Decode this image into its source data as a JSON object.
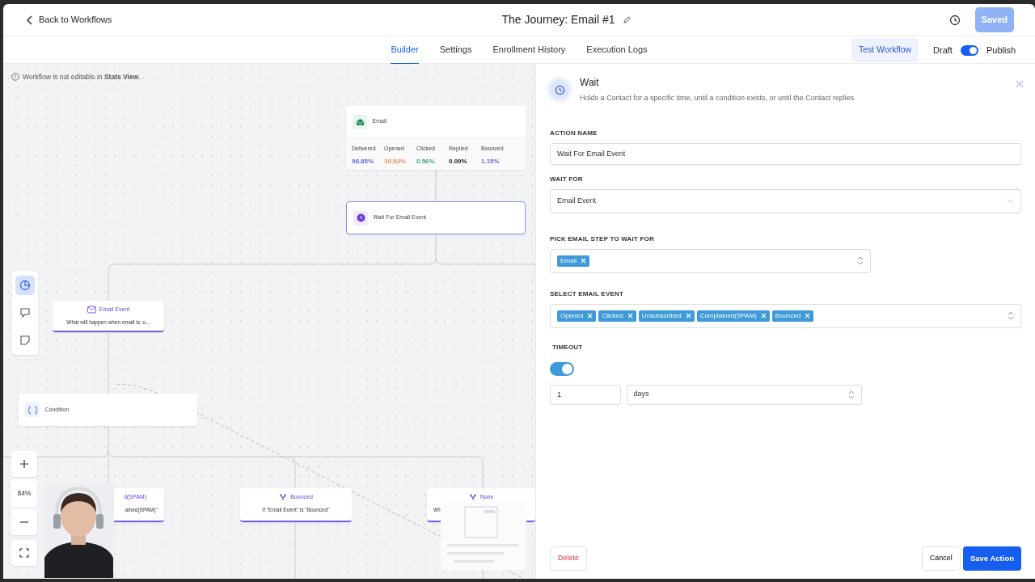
{
  "header": {
    "back_link": "Back to Workflows",
    "title": "The Journey: Email #1",
    "saved_button": "Saved"
  },
  "tabs": [
    {
      "label": "Builder",
      "selected": true
    },
    {
      "label": "Settings",
      "selected": false
    },
    {
      "label": "Enrollment History",
      "selected": false
    },
    {
      "label": "Execution Logs",
      "selected": false
    }
  ],
  "test_workflow_button": "Test Workflow",
  "draft_label": "Draft",
  "publish_toggle": {
    "on": true
  },
  "publish_label": "Publish",
  "canvas": {
    "notice": "Workflow is not editable in **Stats View**.",
    "tool_rail": [
      {
        "kind": "stats",
        "selected": true
      },
      {
        "kind": "comment",
        "selected": false
      },
      {
        "kind": "note",
        "selected": false
      }
    ],
    "zoom": "84%",
    "nodes": [
      {
        "kind": "email",
        "title": "Email",
        "stats": [
          {
            "label": "Delivered",
            "value": "98.85%",
            "color": "#5b6cf0"
          },
          {
            "label": "Opened",
            "value": "10.53%",
            "color": "#f08a5d"
          },
          {
            "label": "Clicked",
            "value": "0.56%",
            "color": "#3aa876"
          },
          {
            "label": "Replied",
            "value": "0.00%",
            "color": "#222222"
          },
          {
            "label": "Bounced",
            "value": "1.15%",
            "color": "#7b5ce0"
          }
        ]
      },
      {
        "kind": "wait",
        "title": "Wait For Email Event",
        "selected": true
      },
      {
        "kind": "event",
        "title": "Email Event",
        "subtitle": "What will happen when email is: o..."
      },
      {
        "kind": "condition",
        "title": "Condition"
      },
      {
        "kind": "branch",
        "title": "d(SPAM)",
        "subtitle": "ained(SPAM)\""
      },
      {
        "kind": "branch",
        "title": "Bounced",
        "subtitle": "If \"Email Event\" is \"Bounced\""
      },
      {
        "kind": "branch",
        "title": "None",
        "subtitle": "Wh"
      }
    ]
  },
  "panel": {
    "title": "Wait",
    "description": "Holds a Contact for a specific time, until a condition exists, or until the Contact replies",
    "action_name": {
      "label": "ACTION NAME",
      "value": "Wait For Email Event"
    },
    "wait_for": {
      "label": "WAIT FOR",
      "value": "Email Event"
    },
    "email_step": {
      "label": "PICK EMAIL STEP TO WAIT FOR",
      "tags": [
        "Email"
      ]
    },
    "email_event": {
      "label": "SELECT EMAIL EVENT",
      "tags": [
        "Opened",
        "Clicked",
        "Unsubscribed",
        "Complained(SPAM)",
        "Bounced"
      ]
    },
    "timeout": {
      "label": "TIMEOUT",
      "on": true,
      "amount": "1",
      "unit": "days"
    },
    "delete_button": "Delete",
    "cancel_button": "Cancel",
    "save_button": "Save Action"
  }
}
